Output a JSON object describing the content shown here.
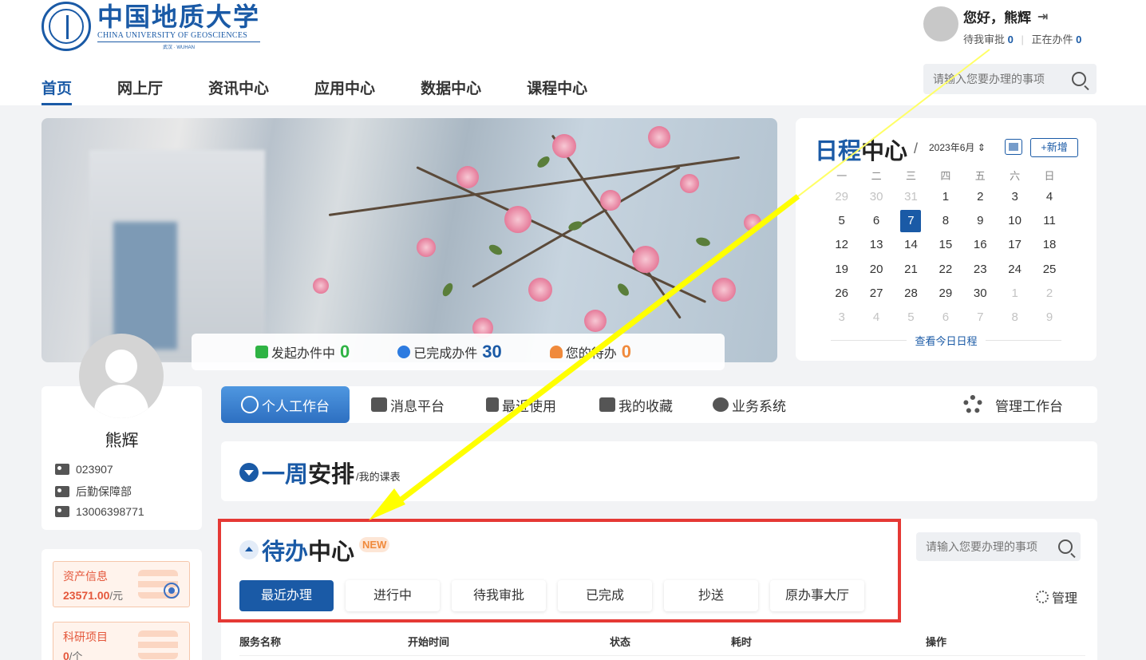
{
  "logo": {
    "cn": "中国地质大学",
    "en": "CHINA UNIVERSITY OF GEOSCIENCES",
    "sub": "武汉 · WUHAN"
  },
  "nav": [
    "首页",
    "网上厅",
    "资讯中心",
    "应用中心",
    "数据中心",
    "课程中心"
  ],
  "user_top": {
    "greeting": "您好，熊辉",
    "pending_label": "待我审批",
    "pending_count": "0",
    "doing_label": "正在办件",
    "doing_count": "0"
  },
  "search_top": {
    "placeholder": "请输入您要办理的事项"
  },
  "stats": [
    {
      "label": "发起办件中",
      "value": "0",
      "color": "#2fb344"
    },
    {
      "label": "已完成办件",
      "value": "30",
      "color": "#1a5aa6"
    },
    {
      "label": "您的待办",
      "value": "0",
      "color": "#f08a3c"
    }
  ],
  "calendar": {
    "title_blue": "日程",
    "title_black": "中心",
    "slash": "/",
    "month": "2023年6月",
    "add_label": "+新增",
    "weekdays": [
      "一",
      "二",
      "三",
      "四",
      "五",
      "六",
      "日"
    ],
    "days": [
      "29",
      "30",
      "31",
      "1",
      "2",
      "3",
      "4",
      "5",
      "6",
      "7",
      "8",
      "9",
      "10",
      "11",
      "12",
      "13",
      "14",
      "15",
      "16",
      "17",
      "18",
      "19",
      "20",
      "21",
      "22",
      "23",
      "24",
      "25",
      "26",
      "27",
      "28",
      "29",
      "30",
      "1",
      "2",
      "3",
      "4",
      "5",
      "6",
      "7",
      "8",
      "9"
    ],
    "today_index": 9,
    "foot": "查看今日日程"
  },
  "user": {
    "name": "熊辉",
    "id": "023907",
    "dept": "后勤保障部",
    "phone": "13006398771"
  },
  "side_cards": [
    {
      "title": "资产信息",
      "value": "23571.00",
      "unit": "/元"
    },
    {
      "title": "科研项目",
      "value": "0",
      "unit": "/个"
    }
  ],
  "tabs": [
    "个人工作台",
    "消息平台",
    "最近使用",
    "我的收藏",
    "业务系统"
  ],
  "admin_tab": "管理工作台",
  "week": {
    "title_blue": "一周",
    "title_black": "安排",
    "sub": "/我的课表"
  },
  "todo": {
    "title_blue": "待办",
    "title_black": "中心",
    "badge": "NEW",
    "search_placeholder": "请输入您要办理的事项",
    "tabs": [
      "最近办理",
      "进行中",
      "待我审批",
      "已完成",
      "抄送",
      "原办事大厅"
    ],
    "manage": "管理",
    "headers": [
      "服务名称",
      "开始时间",
      "状态",
      "耗时",
      "操作"
    ]
  }
}
